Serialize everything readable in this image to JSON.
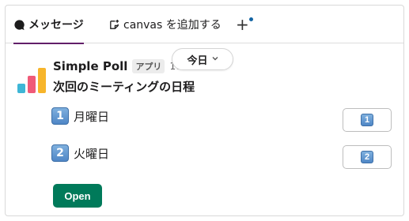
{
  "tabs": {
    "messages_label": "メッセージ",
    "canvas_label": "canvas を追加する",
    "add_label": "+"
  },
  "message": {
    "sender": "Simple Poll",
    "app_badge": "アプリ",
    "timestamp": "10:0",
    "date_pill": "今日",
    "poll_title": "次回のミーティングの日程"
  },
  "poll": {
    "options": [
      {
        "number": "1",
        "label": "月曜日",
        "vote_label": "1"
      },
      {
        "number": "2",
        "label": "火曜日",
        "vote_label": "2"
      }
    ],
    "open_button": "Open"
  },
  "colors": {
    "active_tab_underline": "#611f69",
    "open_button": "#007a5a",
    "notification_dot": "#1264a3",
    "keycap": "#4f86c6"
  },
  "icons": {
    "messages": "speech-bubble-icon",
    "canvas": "canvas-plus-icon",
    "date_chevron": "chevron-down-icon"
  }
}
